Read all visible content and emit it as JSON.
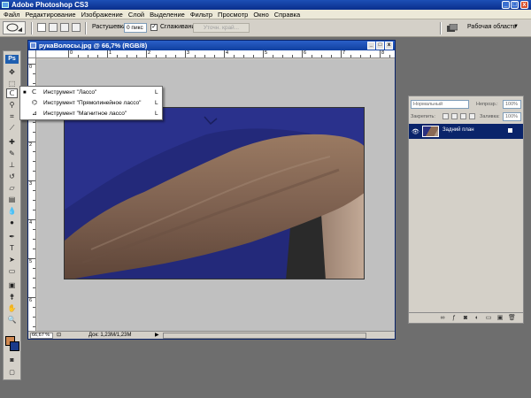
{
  "window": {
    "title": "Adobe Photoshop CS3",
    "controls": [
      "_",
      "□",
      "x"
    ]
  },
  "menubar": {
    "items": [
      "Файл",
      "Редактирование",
      "Изображение",
      "Слой",
      "Выделение",
      "Фильтр",
      "Просмотр",
      "Окно",
      "Справка"
    ]
  },
  "options": {
    "feather_label": "Растушевка:",
    "feather_value": "0 пикс",
    "antialias_label": "Сглаживание",
    "antialias_checked": "✓",
    "refine_edge_label": "Уточн. край...",
    "workspace_label": "Рабочая область"
  },
  "toolbox": {
    "logo": "Ps",
    "tools": [
      "move-icon",
      "marquee-icon",
      "lasso-icon",
      "magic-wand-icon",
      "crop-icon",
      "slice-icon",
      "healing-brush-icon",
      "brush-icon",
      "clone-stamp-icon",
      "history-brush-icon",
      "eraser-icon",
      "gradient-icon",
      "blur-icon",
      "dodge-icon",
      "pen-icon",
      "type-icon",
      "path-selection-icon",
      "shape-icon",
      "notes-icon",
      "eyedropper-icon",
      "hand-icon",
      "zoom-icon"
    ],
    "foreground_color": "#d08850",
    "background_color": "#1a3a8a"
  },
  "document": {
    "title": "рукаВолосы.jpg @ 66,7% (RGB/8)",
    "ruler_h": [
      "0",
      "1",
      "2",
      "3",
      "4",
      "5",
      "6",
      "7",
      "8",
      "9"
    ],
    "ruler_v": [
      "0",
      "1",
      "2",
      "3",
      "4",
      "5",
      "6"
    ],
    "zoom": "66,67 %",
    "doc_size": "Док: 1,23M/1,23M"
  },
  "flyout": {
    "items": [
      {
        "marker": "■",
        "icon": "lasso-icon",
        "label": "Инструмент \"Лассо\"",
        "shortcut": "L"
      },
      {
        "marker": "",
        "icon": "polygonal-lasso-icon",
        "label": "Инструмент \"Прямолинейное лассо\"",
        "shortcut": "L"
      },
      {
        "marker": "",
        "icon": "magnetic-lasso-icon",
        "label": "Инструмент \"Магнитное лассо\"",
        "shortcut": "L"
      }
    ]
  },
  "layers": {
    "blend_mode": "Нормальный",
    "opacity_label": "Непрозр.:",
    "opacity_value": "100%",
    "lock_label": "Закрепить:",
    "fill_label": "Заливка:",
    "fill_value": "100%",
    "layer_name": "Задний план"
  },
  "colors": {
    "titlebar": "#0a2e8c",
    "selection": "#0a246a",
    "shirt": "#23297a"
  }
}
